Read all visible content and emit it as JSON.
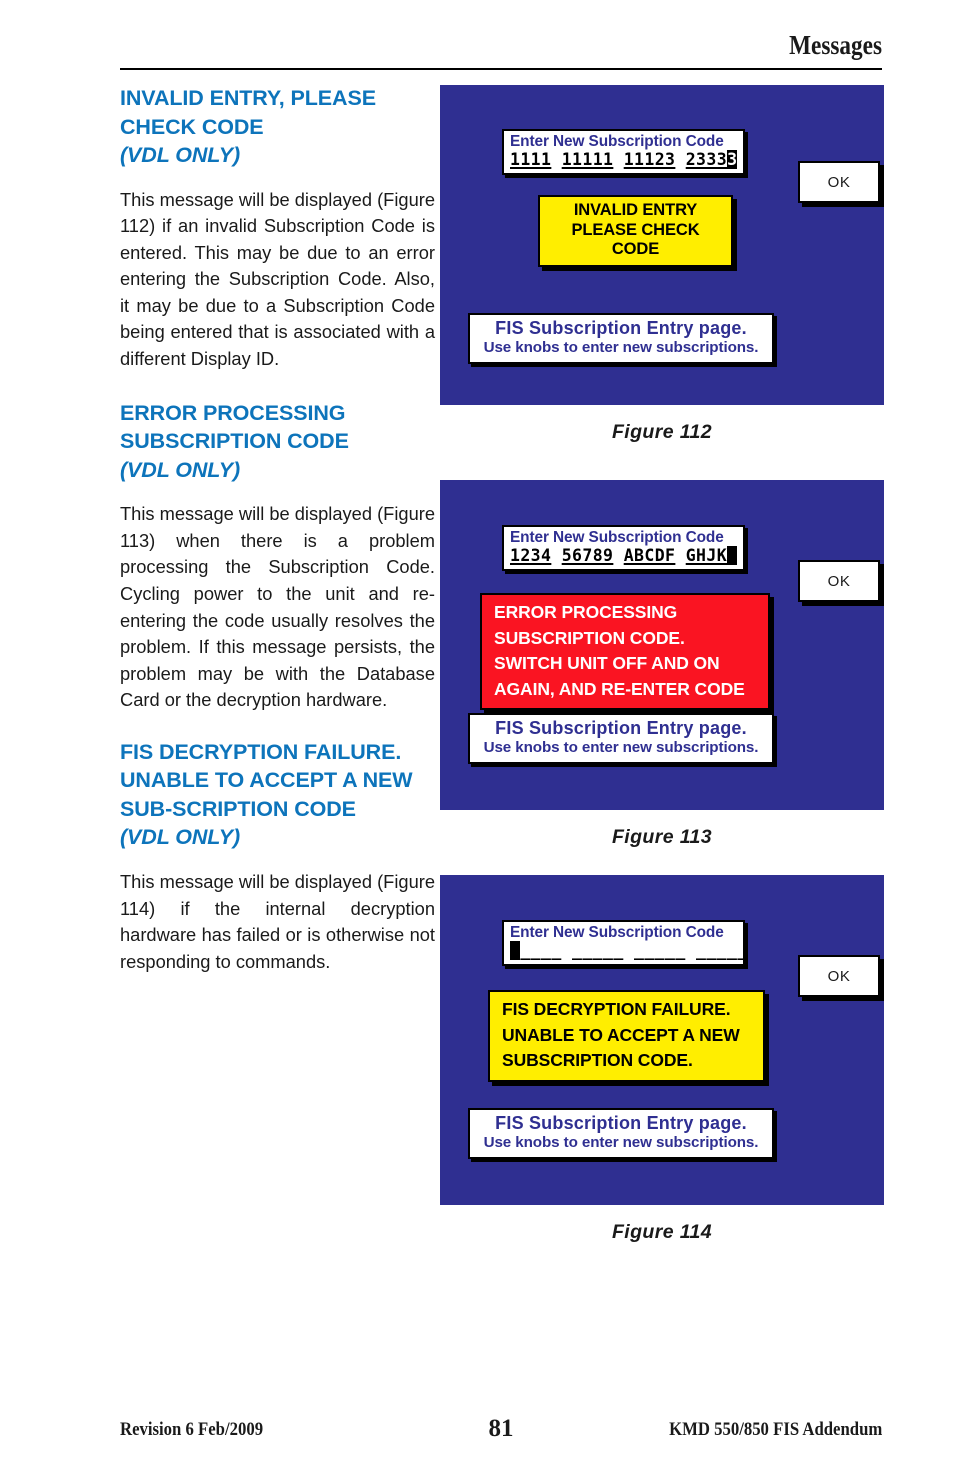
{
  "header": {
    "title": "Messages"
  },
  "sections": [
    {
      "heading_main": "INVALID ENTRY, PLEASE CHECK CODE",
      "heading_sub": "(VDL ONLY)",
      "body": "This message will be displayed (Figure 112) if an invalid Subscription Code is entered. This may be due to an error entering the Subscription Code. Also, it may be due to a Subscription Code being entered that is associated with a different Display ID."
    },
    {
      "heading_main": "ERROR PROCESSING SUBSCRIPTION CODE",
      "heading_sub": "(VDL ONLY)",
      "body": "This message will be displayed (Figure 113) when there is a problem processing the Subscription Code. Cycling power to the unit and re-entering the code usually resolves the problem. If this message persists, the problem may be with the Database Card or the decryption hardware."
    },
    {
      "heading_main": "FIS DECRYPTION FAILURE. UNABLE TO ACCEPT A NEW SUB-SCRIPTION CODE",
      "heading_sub": "(VDL ONLY)",
      "body": "This message will be displayed (Figure 114) if the internal decryption hardware has failed or is otherwise not responding to commands."
    }
  ],
  "figures": [
    {
      "caption": "Figure 112",
      "code_label": "Enter New Subscription Code",
      "code_segments": [
        "1111",
        "11111",
        "11123",
        "2333"
      ],
      "cursor_char": "3",
      "cursor_blank": false,
      "ok_label": "OK",
      "alert_style": "yellow",
      "alert_align": "center",
      "alert_lines": [
        "INVALID ENTRY",
        "PLEASE CHECK CODE"
      ],
      "status_line1": "FIS Subscription Entry page.",
      "status_line2": "Use knobs to enter new subscriptions."
    },
    {
      "caption": "Figure 113",
      "code_label": "Enter New Subscription Code",
      "code_segments": [
        "1234",
        "56789",
        "ABCDF",
        "GHJK"
      ],
      "cursor_char": " ",
      "cursor_blank": true,
      "ok_label": "OK",
      "alert_style": "red",
      "alert_align": "left",
      "alert_lines": [
        "ERROR PROCESSING",
        "SUBSCRIPTION CODE.",
        "SWITCH UNIT OFF AND ON",
        "AGAIN, AND RE-ENTER CODE"
      ],
      "status_line1": "FIS Subscription Entry page.",
      "status_line2": "Use knobs to enter new subscriptions."
    },
    {
      "caption": "Figure 114",
      "code_label": "Enter New Subscription Code",
      "code_segments": [
        "",
        "",
        "",
        ""
      ],
      "cursor_char": " ",
      "cursor_blank": true,
      "empty_dashes": "____ _____ _____ _____",
      "ok_label": "OK",
      "alert_style": "yellow",
      "alert_align": "left",
      "alert_lines": [
        "FIS DECRYPTION FAILURE.",
        "UNABLE TO ACCEPT A NEW",
        "SUBSCRIPTION CODE."
      ],
      "status_line1": "FIS Subscription Entry page.",
      "status_line2": "Use knobs to enter new subscriptions."
    }
  ],
  "footer": {
    "revision": "Revision 6  Feb/2009",
    "page_number": "81",
    "document": "KMD 550/850 FIS Addendum"
  },
  "colors": {
    "heading_blue": "#0d74bb",
    "screen_blue": "#2f2f91",
    "alert_yellow": "#ffee00",
    "alert_red": "#fa1422"
  }
}
